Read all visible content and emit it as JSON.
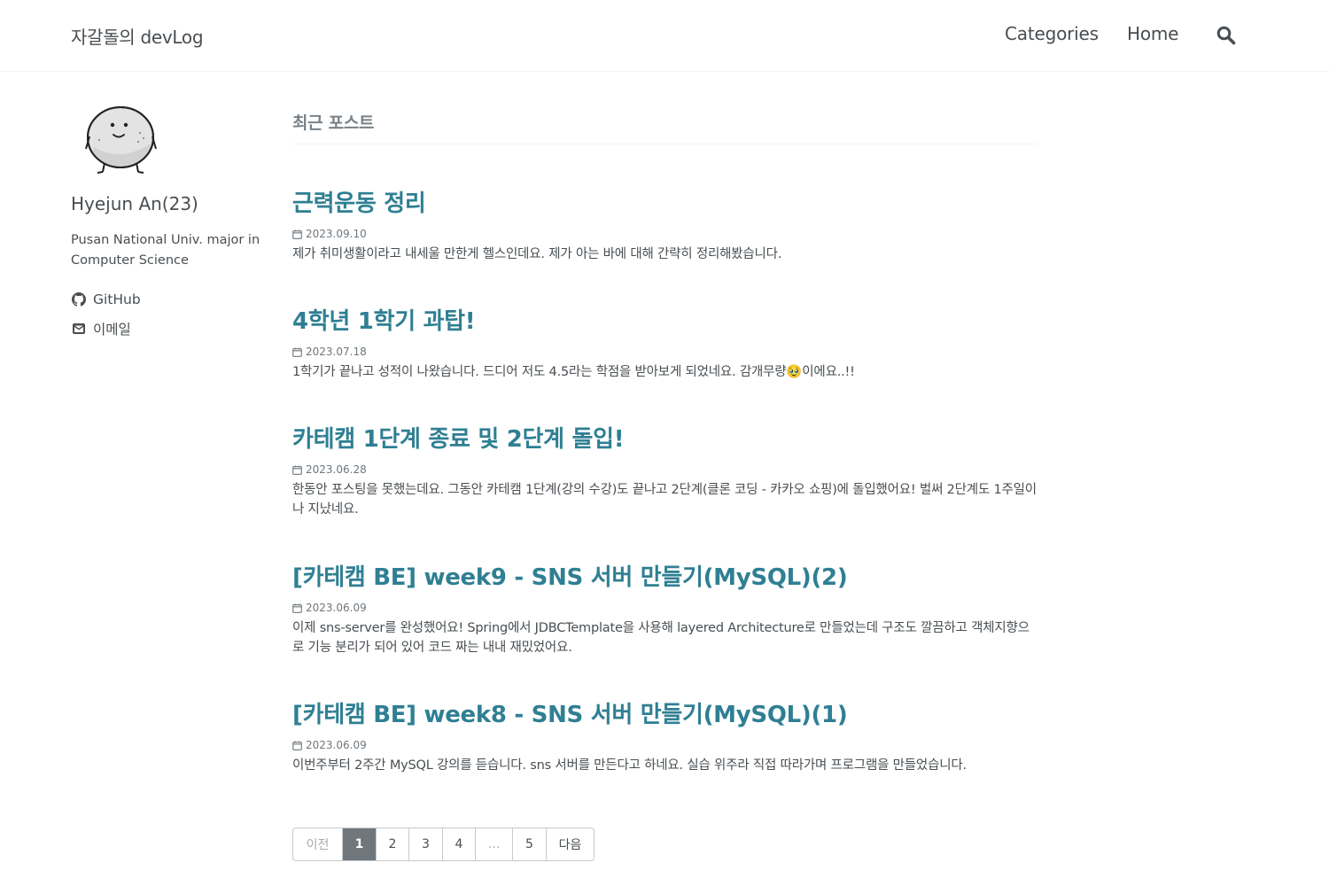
{
  "header": {
    "site_title": "자갈돌의 devLog",
    "nav": [
      {
        "label": "Categories"
      },
      {
        "label": "Home"
      }
    ],
    "search_icon": "search-icon"
  },
  "sidebar": {
    "avatar_icon": "pebble-avatar",
    "name": "Hyejun An(23)",
    "bio": "Pusan National Univ. major in Computer Science",
    "links": [
      {
        "icon": "github-icon",
        "label": "GitHub"
      },
      {
        "icon": "envelope-icon",
        "label": "이메일"
      }
    ]
  },
  "main": {
    "heading": "최근 포스트",
    "posts": [
      {
        "title": "근력운동 정리",
        "date": "2023.09.10",
        "excerpt": "제가 취미생활이라고 내세울 만한게 헬스인데요. 제가 아는 바에 대해 간략히 정리해봤습니다."
      },
      {
        "title": "4학년 1학기 과탑!",
        "date": "2023.07.18",
        "excerpt": "1학기가 끝나고 성적이 나왔습니다. 드디어 저도 4.5라는 학점을 받아보게 되었네요. 감개무량🥹이에요..!!"
      },
      {
        "title": "카테캠 1단계 종료 및 2단계 돌입!",
        "date": "2023.06.28",
        "excerpt": "한동안 포스팅을 못했는데요. 그동안 카테캠 1단계(강의 수강)도 끝나고 2단계(클론 코딩 - 카카오 쇼핑)에 돌입했어요! 벌써 2단계도 1주일이나 지났네요."
      },
      {
        "title": "[카테캠 BE] week9 - SNS 서버 만들기(MySQL)(2)",
        "date": "2023.06.09",
        "excerpt": "이제 sns-server를 완성했어요! Spring에서 JDBCTemplate을 사용해 layered Architecture로 만들었는데 구조도 깔끔하고 객체지향으로 기능 분리가 되어 있어 코드 짜는 내내 재밌었어요."
      },
      {
        "title": "[카테캠 BE] week8 - SNS 서버 만들기(MySQL)(1)",
        "date": "2023.06.09",
        "excerpt": "이번주부터 2주간 MySQL 강의를 듣습니다. sns 서버를 만든다고 하네요. 실습 위주라 직접 따라가며 프로그램을 만들었습니다."
      }
    ]
  },
  "pagination": {
    "prev_label": "이전",
    "pages": [
      "1",
      "2",
      "3",
      "4",
      "…",
      "5"
    ],
    "current": "1",
    "next_label": "다음"
  },
  "colors": {
    "link": "#2f7f93",
    "text": "#494e52",
    "muted": "#7a8288",
    "current_page_bg": "#6f777d"
  }
}
